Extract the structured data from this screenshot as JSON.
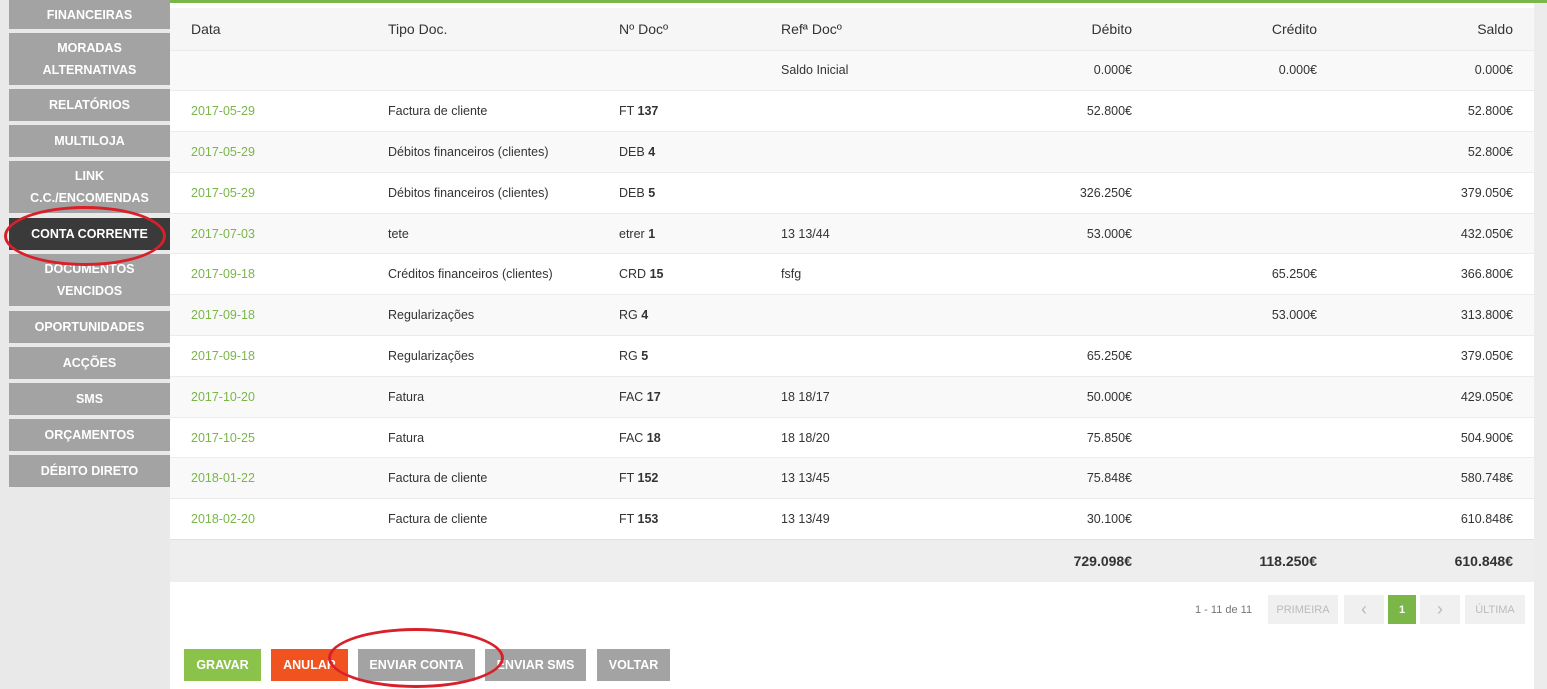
{
  "sidebar": {
    "items": [
      {
        "lines": [
          "FINANCEIRAS"
        ]
      },
      {
        "lines": [
          "MORADAS",
          "ALTERNATIVAS"
        ]
      },
      {
        "lines": [
          "RELATÓRIOS"
        ]
      },
      {
        "lines": [
          "MULTILOJA"
        ]
      },
      {
        "lines": [
          "LINK",
          "C.C./ENCOMENDAS"
        ]
      },
      {
        "lines": [
          "CONTA CORRENTE"
        ]
      },
      {
        "lines": [
          "DOCUMENTOS",
          "VENCIDOS"
        ]
      },
      {
        "lines": [
          "OPORTUNIDADES"
        ]
      },
      {
        "lines": [
          "ACÇÕES"
        ]
      },
      {
        "lines": [
          "SMS"
        ]
      },
      {
        "lines": [
          "ORÇAMENTOS"
        ]
      },
      {
        "lines": [
          "DÉBITO DIRETO"
        ]
      }
    ]
  },
  "table": {
    "headers": [
      "Data",
      "Tipo Doc.",
      "Nº Docº",
      "Refª Docº",
      "Débito",
      "Crédito",
      "Saldo"
    ],
    "initial": {
      "ref": "Saldo Inicial",
      "debito": "0.000€",
      "credito": "0.000€",
      "saldo": "0.000€"
    },
    "rows": [
      {
        "date": "2017-05-29",
        "tipo": "Factura de cliente",
        "doc_prefix": "FT",
        "doc_num": "137",
        "ref": "",
        "debito": "52.800€",
        "credito": "",
        "saldo": "52.800€"
      },
      {
        "date": "2017-05-29",
        "tipo": "Débitos financeiros (clientes)",
        "doc_prefix": "DEB",
        "doc_num": "4",
        "ref": "",
        "debito": "",
        "credito": "",
        "saldo": "52.800€"
      },
      {
        "date": "2017-05-29",
        "tipo": "Débitos financeiros (clientes)",
        "doc_prefix": "DEB",
        "doc_num": "5",
        "ref": "",
        "debito": "326.250€",
        "credito": "",
        "saldo": "379.050€"
      },
      {
        "date": "2017-07-03",
        "tipo": "tete",
        "doc_prefix": "etrer",
        "doc_num": "1",
        "ref": "13 13/44",
        "debito": "53.000€",
        "credito": "",
        "saldo": "432.050€"
      },
      {
        "date": "2017-09-18",
        "tipo": "Créditos financeiros (clientes)",
        "doc_prefix": "CRD",
        "doc_num": "15",
        "ref": "fsfg",
        "debito": "",
        "credito": "65.250€",
        "saldo": "366.800€"
      },
      {
        "date": "2017-09-18",
        "tipo": "Regularizações",
        "doc_prefix": "RG",
        "doc_num": "4",
        "ref": "",
        "debito": "",
        "credito": "53.000€",
        "saldo": "313.800€"
      },
      {
        "date": "2017-09-18",
        "tipo": "Regularizações",
        "doc_prefix": "RG",
        "doc_num": "5",
        "ref": "",
        "debito": "65.250€",
        "credito": "",
        "saldo": "379.050€"
      },
      {
        "date": "2017-10-20",
        "tipo": "Fatura",
        "doc_prefix": "FAC",
        "doc_num": "17",
        "ref": "18 18/17",
        "debito": "50.000€",
        "credito": "",
        "saldo": "429.050€"
      },
      {
        "date": "2017-10-25",
        "tipo": "Fatura",
        "doc_prefix": "FAC",
        "doc_num": "18",
        "ref": "18 18/20",
        "debito": "75.850€",
        "credito": "",
        "saldo": "504.900€"
      },
      {
        "date": "2018-01-22",
        "tipo": "Factura de cliente",
        "doc_prefix": "FT",
        "doc_num": "152",
        "ref": "13 13/45",
        "debito": "75.848€",
        "credito": "",
        "saldo": "580.748€"
      },
      {
        "date": "2018-02-20",
        "tipo": "Factura de cliente",
        "doc_prefix": "FT",
        "doc_num": "153",
        "ref": "13 13/49",
        "debito": "30.100€",
        "credito": "",
        "saldo": "610.848€"
      }
    ],
    "totals": {
      "debito": "729.098€",
      "credito": "118.250€",
      "saldo": "610.848€"
    }
  },
  "pagination": {
    "range": "1 - 11 de 11",
    "first": "PRIMEIRA",
    "prev_icon": "chevron-left-icon",
    "prev": "‹",
    "current": "1",
    "next_icon": "chevron-right-icon",
    "next": "›",
    "last": "ÚLTIMA"
  },
  "actions": {
    "gravar": "GRAVAR",
    "anular": "ANULAR",
    "enviar_conta": "ENVIAR CONTA",
    "enviar_sms": "ENVIAR SMS",
    "voltar": "VOLTAR"
  },
  "colors": {
    "accent_green": "#7ab648",
    "danger_orange": "#f0531f",
    "sidebar_grey": "#a3a3a3",
    "active_dark": "#3a3a3a",
    "annotation_red": "#d9202a"
  }
}
